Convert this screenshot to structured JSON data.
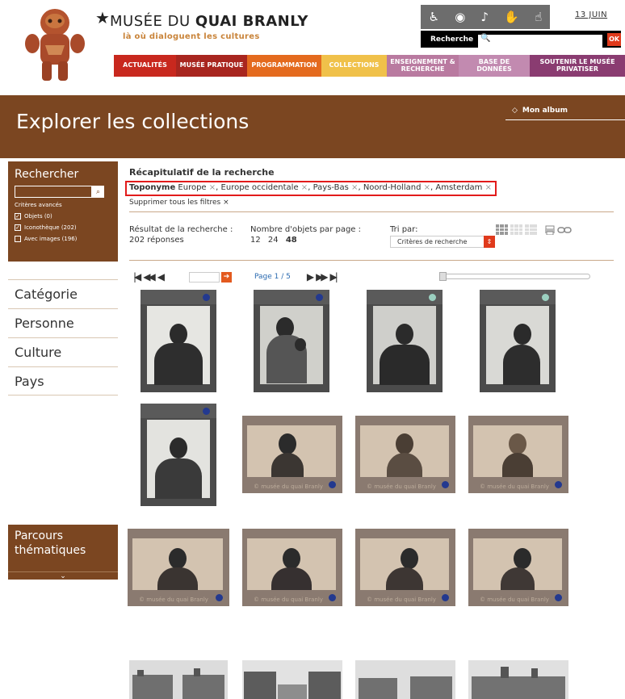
{
  "header": {
    "brand_star": "★",
    "brand_prefix": "MUSÉE DU ",
    "brand_bold": "QUAI BRANLY",
    "tagline": "là où dialoguent les cultures",
    "date": "13 JUIN",
    "access_icons": [
      "wheelchair-icon",
      "eye-icon",
      "ear-icon",
      "hand-icon",
      "sign-language-icon"
    ],
    "access_glyphs": [
      "♿",
      "◉",
      "♪",
      "✋",
      "☝"
    ],
    "search_label": "Recherche",
    "search_icon": "🔍",
    "search_placeholder": "",
    "search_ok": "OK"
  },
  "nav": [
    {
      "label": "ACTUALITÉS",
      "color": "#c8281e"
    },
    {
      "label": "MUSÉE PRATIQUE",
      "color": "#a8261f"
    },
    {
      "label": "PROGRAMMATION",
      "color": "#e46a1e"
    },
    {
      "label": "COLLECTIONS",
      "color": "#f0c14a"
    },
    {
      "label": "ENSEIGNEMENT & RECHERCHE",
      "color": "#b97aa0"
    },
    {
      "label": "BASE DE DONNÉES",
      "color": "#c28ab0"
    },
    {
      "label": "SOUTENIR LE MUSÉE PRIVATISER",
      "color": "#8a3c71"
    }
  ],
  "banner": {
    "title": "Explorer les collections",
    "album_icon": "◇",
    "album": "Mon album"
  },
  "sidebar": {
    "search_title": "Rechercher",
    "search_go": "⌕",
    "advanced": "Critères avancés",
    "checks": [
      {
        "label": "Objets (0)",
        "checked": "✓"
      },
      {
        "label": "Iconothèque (202)",
        "checked": "✓"
      },
      {
        "label": "Avec images (196)",
        "checked": ""
      }
    ],
    "facets": [
      "Catégorie",
      "Personne",
      "Culture",
      "Pays"
    ],
    "parcours_line1": "Parcours",
    "parcours_line2": "thématiques",
    "parcours_chevron": "⌄"
  },
  "recap": {
    "title": "Récapitulatif de la recherche",
    "filter_key": "Toponyme",
    "filters": [
      "Europe",
      "Europe occidentale",
      "Pays-Bas",
      "Noord-Holland",
      "Amsterdam"
    ],
    "remove": "×",
    "clear_all": "Supprimer tous les filtres ×"
  },
  "results": {
    "label_line1": "Résultat de la recherche :",
    "label_line2": "202 réponses",
    "per_page_label": "Nombre d'objets par page :",
    "per_page_options": [
      "12",
      "24",
      "48"
    ],
    "sort_label": "Tri par:",
    "sort_value": "Critères de recherche",
    "sort_arrow": "⇕"
  },
  "pager": {
    "first": "|◀",
    "rewind": "◀◀",
    "prev": "◀",
    "go": "➔",
    "label": "Page 1 / 5",
    "next": "▶",
    "forward": "▶▶",
    "last": "▶|"
  },
  "watermark": "© musée du quai Branly"
}
